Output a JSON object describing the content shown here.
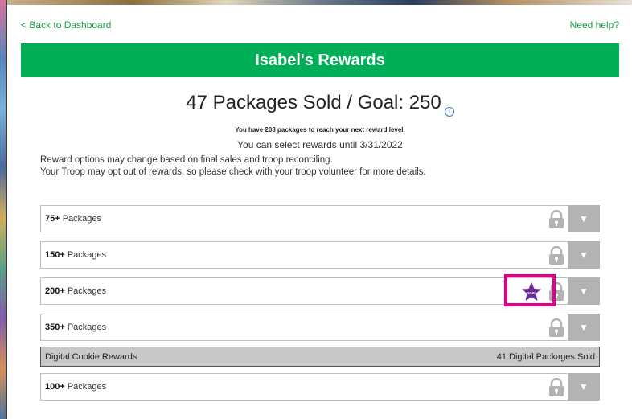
{
  "nav": {
    "back_link": "< Back to Dashboard",
    "help_link": "Need help?"
  },
  "banner": {
    "title": "Isabel's Rewards"
  },
  "summary": {
    "headline": "47 Packages Sold / Goal: 250",
    "info_icon": "info-icon",
    "reach_text": "You have 203 packages to reach your next reward level.",
    "select_until": "You can select rewards until 3/31/2022",
    "note_1": "Reward options may change based on final sales and troop reconciling.",
    "note_2": "Your Troop may opt out of rewards, so please check with your troop volunteer for more details."
  },
  "reward_levels": [
    {
      "amount": "75+",
      "unit": " Packages",
      "locked": true
    },
    {
      "amount": "150+",
      "unit": " Packages",
      "locked": true
    },
    {
      "amount": "200+",
      "unit": " Packages",
      "locked": true,
      "goal_badge": "GOAL"
    },
    {
      "amount": "350+",
      "unit": " Packages",
      "locked": true
    }
  ],
  "digital": {
    "label": "Digital Cookie Rewards",
    "count": "41 Digital Packages Sold"
  },
  "digital_levels": [
    {
      "amount": "100+",
      "unit": " Packages",
      "locked": true
    }
  ],
  "colors": {
    "brand_green": "#00ae58",
    "link_green": "#1a9e45",
    "highlight_magenta": "#e4008f",
    "goal_purple": "#6a2c91"
  }
}
